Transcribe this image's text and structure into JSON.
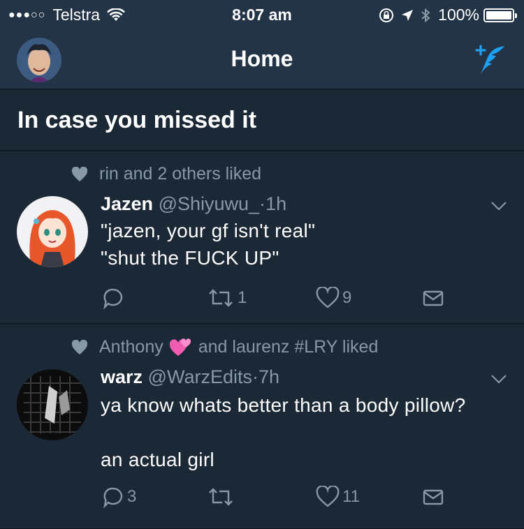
{
  "status_bar": {
    "carrier": "Telstra",
    "time": "8:07 am",
    "battery": "100%"
  },
  "nav": {
    "title": "Home"
  },
  "section": {
    "title": "In case you missed it"
  },
  "tweets": [
    {
      "social_context": "rin and 2 others liked",
      "name": "Jazen",
      "handle": "@Shiyuwu_",
      "time": "1h",
      "text": "\"jazen, your gf isn't real\"\n\"shut the FUCK UP\"",
      "replies": "",
      "retweets": "1",
      "likes": "9"
    },
    {
      "social_context_first": "Anthony",
      "social_context_rest": "and laurenz #LRY liked",
      "name": "warz",
      "handle": "@WarzEdits",
      "time": "7h",
      "text": "ya know whats better than a body pillow?\n\nan actual girl",
      "replies": "3",
      "retweets": "",
      "likes": "11"
    }
  ],
  "colors": {
    "bar": "#243447",
    "card": "#1b2836",
    "muted": "#8899a6",
    "accent": "#1da1f2"
  }
}
